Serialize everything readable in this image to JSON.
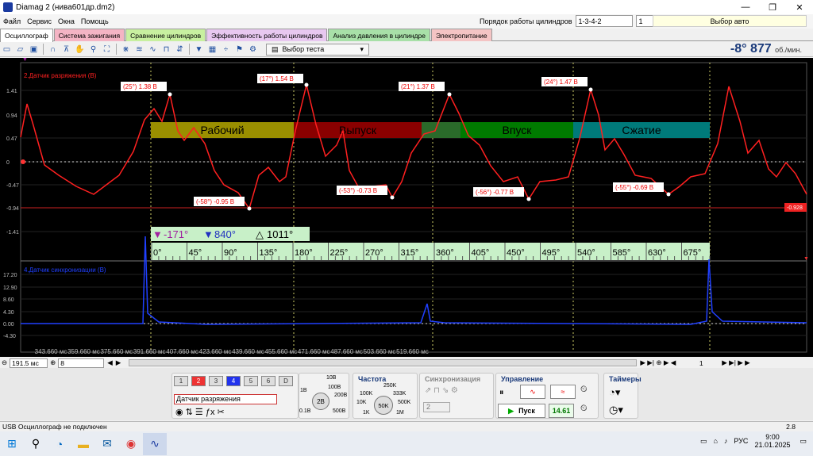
{
  "window": {
    "title": "Diamag 2 (нива601др.dm2)",
    "min": "—",
    "max": "❐",
    "close": "✕"
  },
  "menu": [
    "Файл",
    "Сервис",
    "Окна",
    "Помощь"
  ],
  "cylinders": {
    "label": "Порядок работы цилиндров",
    "order": "1-3-4-2",
    "count": "1",
    "auto": "Выбор авто"
  },
  "tabs": [
    {
      "label": "Осциллограф",
      "color": "#ffffff"
    },
    {
      "label": "Система зажигания",
      "color": "#f4b4c4"
    },
    {
      "label": "Сравнение цилиндров",
      "color": "#c8f0a0"
    },
    {
      "label": "Эффективность работы цилиндров",
      "color": "#e8c8f0"
    },
    {
      "label": "Анализ давления в цилиндре",
      "color": "#a8e0a8"
    },
    {
      "label": "Электропитание",
      "color": "#f4c4c4"
    }
  ],
  "toolbar": {
    "test": "Выбор теста",
    "rpm": "-8° 877",
    "rpm_unit": "об./мин."
  },
  "scope": {
    "ch2_label": "2.Датчик разряжения (В)",
    "ch4_label": "4.Датчик синхронизации (В)",
    "ch2_ticks": [
      "1.41",
      "0.94",
      "0.47",
      "0",
      "-0.47",
      "-0.94",
      "-1.41"
    ],
    "ch4_ticks": [
      "17.20",
      "12.90",
      "8.60",
      "4.30",
      "0.00",
      "-4.30"
    ],
    "cursor_value": "-0.928",
    "phases": [
      {
        "label": "Рабочий",
        "color": "#9a8f00"
      },
      {
        "label": "Выпуск",
        "color": "#8a0000"
      },
      {
        "label": "",
        "color": "#2a6a2a"
      },
      {
        "label": "Впуск",
        "color": "#007a00"
      },
      {
        "label": "Сжатие",
        "color": "#007a7a"
      }
    ],
    "peaks": [
      "(25°) 1.38 В",
      "(17°) 1.54 В",
      "(21°) 1.37 В",
      "(24°) 1.47 В"
    ],
    "troughs": [
      "(-58°) -0.95 В",
      "(-53°) -0.73 В",
      "(-56°) -0.77 В",
      "(-55°) -0.69 В"
    ],
    "markers": {
      "m1": "-171°",
      "m2": "840°",
      "delta": "1011°"
    },
    "deg_ticks": [
      "0°",
      "45°",
      "90°",
      "135°",
      "180°",
      "225°",
      "270°",
      "315°",
      "360°",
      "405°",
      "450°",
      "495°",
      "540°",
      "585°",
      "630°",
      "675°"
    ],
    "time_ticks": [
      "343.660 мс",
      "359.660 мс",
      "375.660 мс",
      "391.660 мс",
      "407.660 мс",
      "423.660 мс",
      "439.660 мс",
      "455.660 мс",
      "471.660 мс",
      "487.660 мс",
      "503.660 мс",
      "519.660 мс"
    ]
  },
  "statusrow": {
    "timebase": "191.5 мс",
    "channel": "8",
    "page": "1"
  },
  "panel": {
    "channels": [
      "1",
      "2",
      "3",
      "4",
      "5",
      "6",
      "D"
    ],
    "sensor": "Датчик разряжения",
    "voltage_title": "",
    "volt_labels": [
      "10В",
      "1В",
      "100В",
      "200В",
      "0.1В",
      "500В",
      "2В"
    ],
    "freq_title": "Частота",
    "freq_labels": [
      "250K",
      "100K",
      "333K",
      "10K",
      "500K",
      "1K",
      "1M",
      "50K"
    ],
    "sync_title": "Синхронизация",
    "sync_value": "2",
    "ctrl_title": "Управление",
    "start": "Пуск",
    "value": "14.61",
    "timers_title": "Таймеры"
  },
  "status": {
    "left": "USB Осциллограф не подключен",
    "right": "2.8"
  },
  "clock": {
    "time": "9:00",
    "date": "21.01.2025",
    "lang": "РУС"
  },
  "colors": {
    "ch2": "#ff2020",
    "ch4": "#2040ff",
    "accent": "#1a3a7a"
  }
}
